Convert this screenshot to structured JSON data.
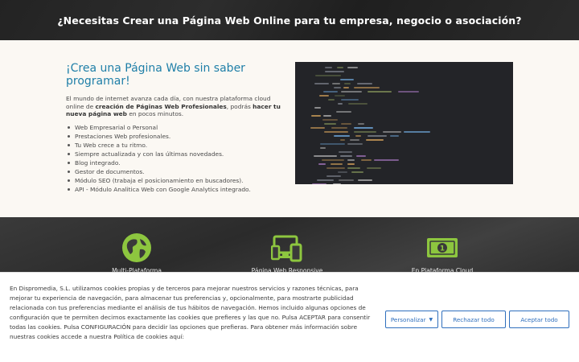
{
  "banner": {
    "title": "¿Necesitas Crear una Página Web Online para tu empresa, negocio o asociación?"
  },
  "intro": {
    "heading": "¡Crea una Página Web sin saber programar!",
    "paragraph_start": "El mundo de internet avanza cada día, con nuestra plataforma cloud online de ",
    "paragraph_bold1": "creación de Páginas Web Profesionales",
    "paragraph_mid": ", podrás ",
    "paragraph_bold2": "hacer tu nueva página web",
    "paragraph_end": " en pocos minutos.",
    "features": [
      "Web Empresarial o Personal",
      "Prestaciones Web profesionales.",
      "Tu Web crece a tu ritmo.",
      "Siempre actualizada y con las últimas novedades.",
      "Blog integrado.",
      "Gestor de documentos.",
      "Módulo SEO (trabaja el posicionamiento en buscadores).",
      "API - Módulo Analitica Web con Google Analytics integrado."
    ]
  },
  "services": {
    "icon_color": "#8dc63f",
    "items": [
      {
        "icon": "globe-icon",
        "label": "Multi-Plataforma"
      },
      {
        "icon": "devices-icon",
        "label": "Página Web Responsive"
      },
      {
        "icon": "money-icon",
        "label": "En Plataforma Cloud"
      }
    ]
  },
  "cookie_banner": {
    "text": "En Dispromedia, S.L. utilizamos cookies propias y de terceros para mejorar nuestros servicios y razones técnicas, para mejorar tu experiencia de navegación, para almacenar tus preferencias y, opcionalmente, para mostrarte publicidad relacionada con tus preferencias mediante el análisis de tus hábitos de navegación.  Hemos incluido algunas opciones de configuración que te permiten decirnos exactamente las cookies que prefieres y las que no. Pulsa ACEPTAR para consentir todas las cookies. Pulsa CONFIGURACIÓN para decidir las opciones que prefieras. Para obtener más información sobre nuestras cookies accede a nuestra Política de cookies aquí:",
    "personalize_label": "Personalizar",
    "reject_label": "Rechazar todo",
    "accept_label": "Aceptar todo",
    "button_color": "#2f6fbd"
  },
  "colors": {
    "heading": "#1f7fa8",
    "banner_bg": "#262626",
    "page_bg": "#fbf8f3"
  }
}
